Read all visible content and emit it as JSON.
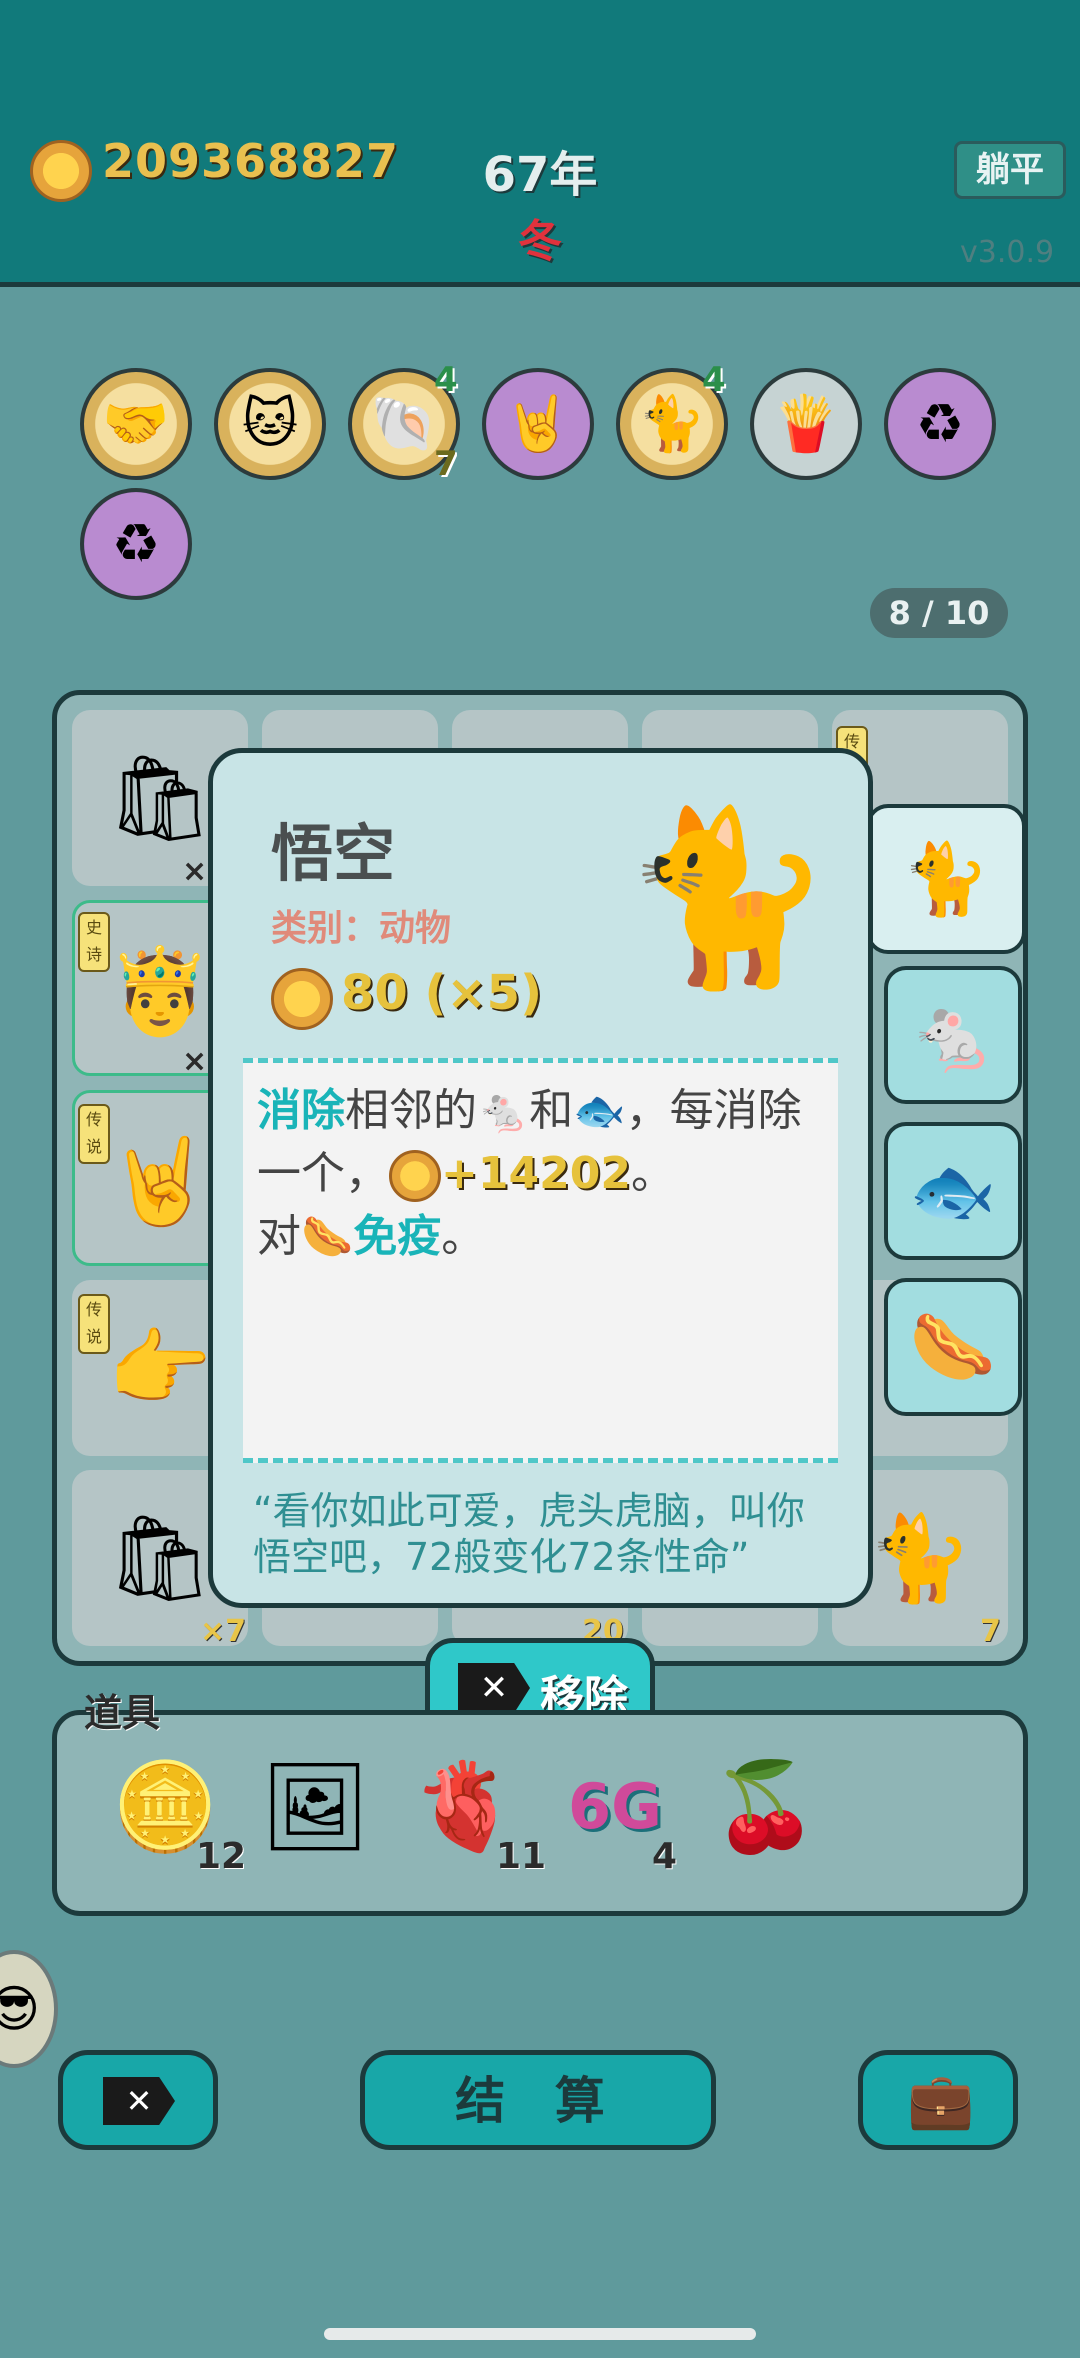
{
  "header": {
    "coins": "209368827",
    "year": "67年",
    "season": "冬",
    "lie_flat_button": "躺平",
    "version": "v3.0.9"
  },
  "relics": [
    {
      "icon": "handshake-icon",
      "count": ""
    },
    {
      "icon": "cat-couple-icon",
      "count": ""
    },
    {
      "icon": "seashell-icon",
      "count_top": "4",
      "count_bottom": "7"
    },
    {
      "icon": "rock-hand-icon",
      "count": ""
    },
    {
      "icon": "black-cat-icon",
      "count_top": "4"
    },
    {
      "icon": "fries-icon",
      "count": ""
    },
    {
      "icon": "recycle-icon",
      "count": ""
    },
    {
      "icon": "recycle-icon",
      "count": ""
    }
  ],
  "progress": "8 / 10",
  "board": {
    "tiles": [
      {
        "icon": "trash-bag-icon",
        "count": "×"
      },
      {
        "icon": "king-icon",
        "tag": "史诗",
        "count": "×"
      },
      {
        "icon": "rock-hand-icon",
        "tag": "传说"
      },
      {
        "icon": "pointing-hand-icon",
        "tag": "传说"
      },
      {
        "icon": "trash-bag-icon",
        "count": "×7"
      },
      {
        "icon": "unknown-tile-icon",
        "count": "20"
      },
      {
        "icon": "cat-icon",
        "count": "7"
      },
      {
        "tag": "传"
      }
    ]
  },
  "side_stack": [
    {
      "icon": "yellow-cat-icon"
    },
    {
      "icon": "mouse-icon"
    },
    {
      "icon": "fish-icon"
    },
    {
      "icon": "sausage-icon"
    }
  ],
  "detail": {
    "name": "悟空",
    "category": "类别：动物",
    "value": "80 (×5)",
    "desc": {
      "kw_remove": "消除",
      "t1": "相邻的",
      "t2": "和",
      "t3": "，每消除一个，",
      "gain": "+14202",
      "t4": "。",
      "t5": "对",
      "kw_immune": "免疫",
      "t6": "。"
    },
    "quote": "“看你如此可爱，虎头虎脑，叫你悟空吧，72般变化72条性命”"
  },
  "remove_button": "移除",
  "items": {
    "label": "道具",
    "list": [
      {
        "icon": "dollar-coin-icon",
        "count": "12"
      },
      {
        "icon": "picture-frame-icon",
        "count": ""
      },
      {
        "icon": "liver-icon",
        "count": "11"
      },
      {
        "icon": "6g-icon",
        "text": "6G",
        "count": "4"
      },
      {
        "icon": "bayberry-icon",
        "count": ""
      }
    ]
  },
  "bottom": {
    "settle": "结 算"
  }
}
